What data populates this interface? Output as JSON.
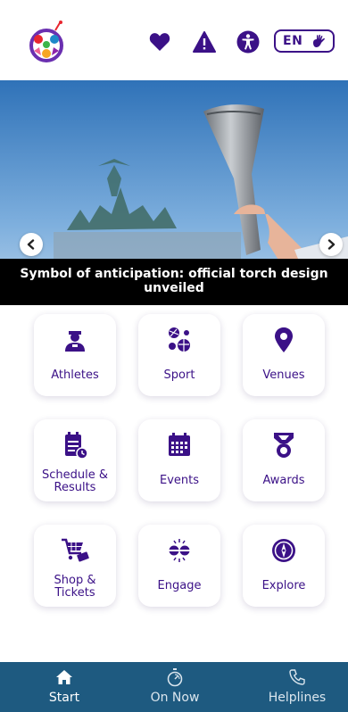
{
  "header": {
    "icons": [
      "heart-icon",
      "warning-icon",
      "accessibility-icon"
    ],
    "language": {
      "label": "EN",
      "icon": "sign-language-hand-icon"
    }
  },
  "hero": {
    "caption": "Symbol of anticipation: official torch design unveiled"
  },
  "tiles": [
    {
      "label": "Athletes",
      "icon": "athlete-icon"
    },
    {
      "label": "Sport",
      "icon": "sport-balls-icon"
    },
    {
      "label": "Venues",
      "icon": "location-pin-icon"
    },
    {
      "label": "Schedule & Results",
      "icon": "schedule-icon"
    },
    {
      "label": "Events",
      "icon": "calendar-icon"
    },
    {
      "label": "Awards",
      "icon": "medal-icon"
    },
    {
      "label": "Shop & Tickets",
      "icon": "shopping-cart-icon"
    },
    {
      "label": "Engage",
      "icon": "engage-icon"
    },
    {
      "label": "Explore",
      "icon": "compass-icon"
    }
  ],
  "bottom_nav": [
    {
      "label": "Start",
      "icon": "home-icon",
      "active": true
    },
    {
      "label": "On Now",
      "icon": "stopwatch-icon",
      "active": false
    },
    {
      "label": "Helplines",
      "icon": "phone-icon",
      "active": false
    }
  ],
  "colors": {
    "accent": "#3b1187",
    "nav_bg": "#1e5a80",
    "caption_bg": "#000000"
  }
}
